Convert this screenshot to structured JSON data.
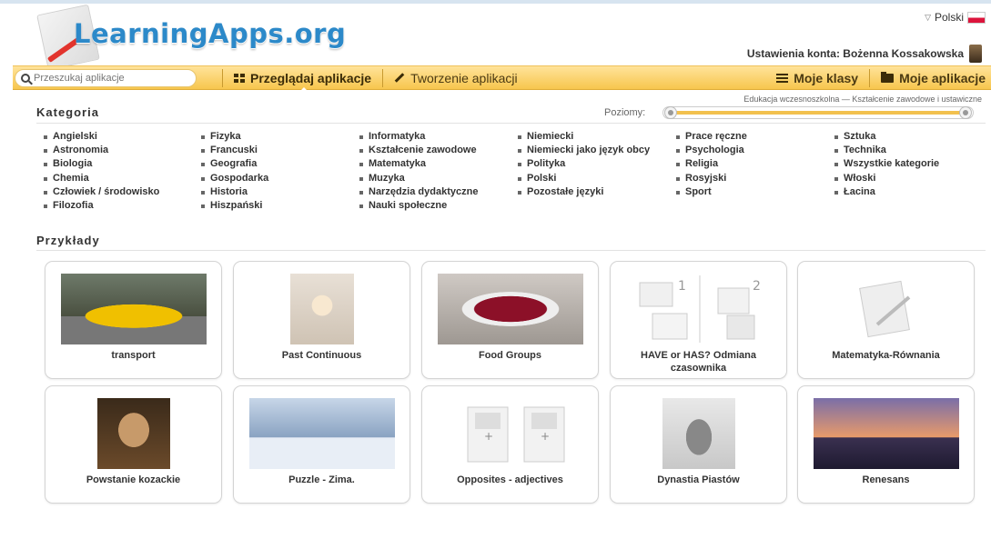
{
  "header": {
    "logo_text": "LearningApps.org",
    "language": "Polski",
    "account": "Ustawienia konta: Bożenna Kossakowska"
  },
  "nav": {
    "search_placeholder": "Przeszukaj aplikacje",
    "browse": "Przeglądaj aplikacje",
    "create": "Tworzenie aplikacji",
    "classes": "Moje klasy",
    "my_apps": "Moje aplikacje"
  },
  "categories": {
    "title": "Kategoria",
    "levels_label": "Poziomy:",
    "levels_caption": "Edukacja wczesnoszkolna — Kształcenie zawodowe i ustawiczne",
    "levels_range": [
      0,
      1
    ],
    "columns": [
      [
        "Angielski",
        "Astronomia",
        "Biologia",
        "Chemia",
        "Człowiek / środowisko",
        "Filozofia"
      ],
      [
        "Fizyka",
        "Francuski",
        "Geografia",
        "Gospodarka",
        "Historia",
        "Hiszpański"
      ],
      [
        "Informatyka",
        "Kształcenie zawodowe",
        "Matematyka",
        "Muzyka",
        "Narzędzia dydaktyczne",
        "Nauki społeczne"
      ],
      [
        "Niemiecki",
        "Niemiecki jako język obcy",
        "Polityka",
        "Polski",
        "Pozostałe języki"
      ],
      [
        "Prace ręczne",
        "Psychologia",
        "Religia",
        "Rosyjski",
        "Sport"
      ],
      [
        "Sztuka",
        "Technika",
        "Wszystkie kategorie",
        "Włoski",
        "Łacina"
      ]
    ]
  },
  "examples": {
    "title": "Przykłady",
    "cards": [
      {
        "label": "transport",
        "thumb": "car-photo"
      },
      {
        "label": "Past Continuous",
        "thumb": "flower-photo"
      },
      {
        "label": "Food Groups",
        "thumb": "berries-photo"
      },
      {
        "label": "HAVE or HAS? Odmiana czasownika",
        "thumb": "matching-template-icon"
      },
      {
        "label": "Matematyka-Równania",
        "thumb": "default-app-icon"
      },
      {
        "label": "Powstanie kozackie",
        "thumb": "portrait-photo"
      },
      {
        "label": "Puzzle - Zima.",
        "thumb": "winter-photo"
      },
      {
        "label": "Opposites - adjectives",
        "thumb": "pairs-template-icon"
      },
      {
        "label": "Dynastia Piastów",
        "thumb": "king-engraving"
      },
      {
        "label": "Renesans",
        "thumb": "rome-photo"
      }
    ]
  },
  "colors": {
    "nav_bar": "#f7c64d",
    "logo_blue": "#2c89c9"
  }
}
